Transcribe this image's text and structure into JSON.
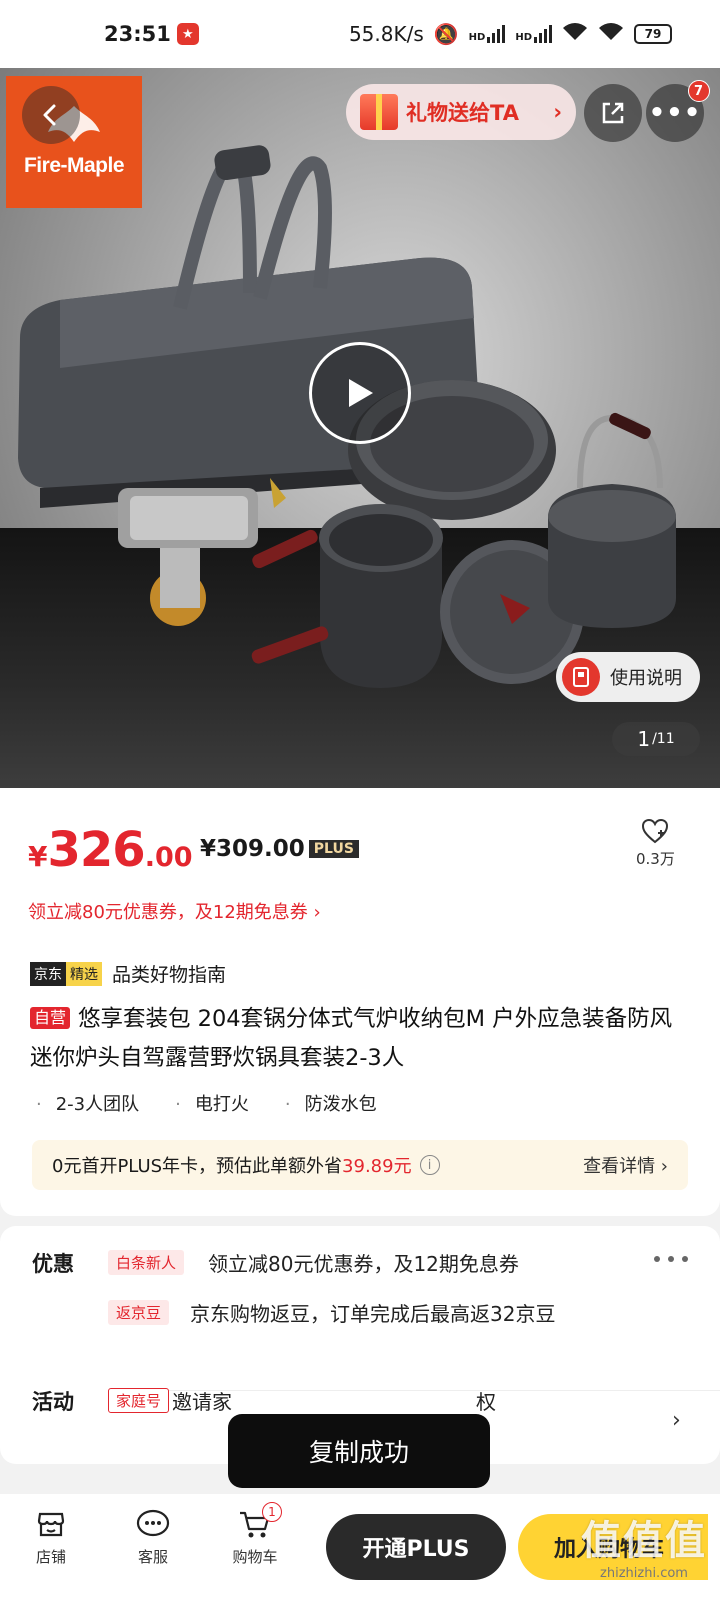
{
  "status_bar": {
    "time": "23:51",
    "net_speed": "55.8K/s",
    "hd_1": "HD",
    "hd_2": "HD",
    "battery": "79"
  },
  "hero": {
    "brand_logo_text": "Fire-Maple",
    "gift_label": "礼物送给TA",
    "more_badge": "7",
    "manual_label": "使用说明",
    "page_current": "1",
    "page_total": "/11"
  },
  "price": {
    "currency": "¥",
    "integer": "326",
    "decimal": ".00",
    "plus_price": "¥309.00",
    "plus_badge": "PLUS",
    "favorites": "0.3万"
  },
  "coupon_line": "领立减80元优惠券，及12期免息券 ›",
  "guide": {
    "badge_a": "京东",
    "badge_b": "精选",
    "text": "品类好物指南"
  },
  "product": {
    "self_tag": "自营",
    "title": "悠享套装包 204套锅分体式气炉收纳包M 户外应急装备防风迷你炉头自驾露营野炊锅具套装2-3人",
    "tags": [
      "2-3人团队",
      "电打火",
      "防泼水包"
    ]
  },
  "plus_bar": {
    "prefix": "0元首开PLUS年卡，预估此单额外省",
    "amount": "39.89元",
    "detail": "查看详情 ›"
  },
  "promotions": {
    "label": "优惠",
    "items": [
      {
        "tag": "白条新人",
        "text": "领立减80元优惠券，及12期免息券"
      },
      {
        "tag": "返京豆",
        "text": "京东购物返豆，订单完成后最高返32京豆"
      }
    ],
    "activity_label": "活动",
    "activity_tag": "家庭号",
    "activity_text_left": "邀请家",
    "activity_text_right": "权"
  },
  "toast": "复制成功",
  "bottom_bar": {
    "shop": "店铺",
    "service": "客服",
    "cart": "购物车",
    "cart_badge": "1",
    "open_plus": "开通PLUS",
    "add_cart": "加入购物车"
  },
  "watermark": {
    "big": "值值值",
    "small": "zhizhizhi.com"
  }
}
